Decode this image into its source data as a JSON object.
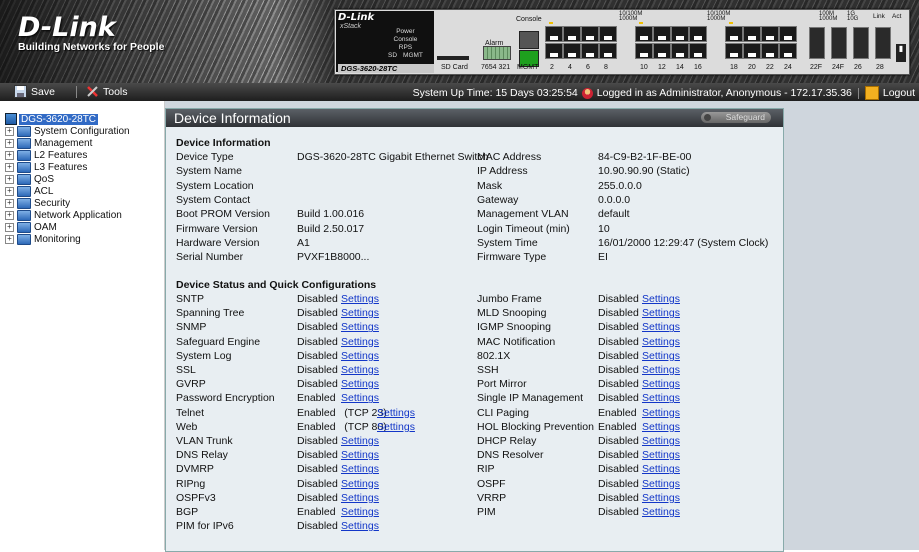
{
  "header": {
    "brand": "D-Link",
    "tagline": "Building Networks for People",
    "panel": {
      "brand": "D-Link",
      "series": "xStack",
      "model": "DGS-3620-28TC",
      "led_labels": [
        "Power",
        "Console",
        "RPS",
        "SD",
        "MGMT"
      ],
      "console_label": "Console",
      "alarm_label": "Alarm",
      "sdcard_label": "SD Card",
      "fan_labels": "7654  321",
      "mgmt_label": "MGMT",
      "port_numbers": [
        "2",
        "4",
        "6",
        "8",
        "10",
        "12",
        "14",
        "16",
        "18",
        "20",
        "22",
        "24",
        "22F",
        "24F",
        "26",
        "28"
      ],
      "speed_legend_1": "10/100M",
      "speed_legend_2": "1000M",
      "speed_legend_3": "100M",
      "speed_legend_4": "1000M",
      "speed_legend_5": "1G",
      "speed_legend_6": "10G",
      "link_act": "Link",
      "act_label": "Act"
    }
  },
  "toolbar": {
    "save_label": "Save",
    "tools_label": "Tools",
    "uptime": "System Up Time: 15 Days 03:25:54",
    "login_info": "Logged in as Administrator, Anonymous - 172.17.35.36",
    "logout_label": "Logout"
  },
  "tree": {
    "root": "DGS-3620-28TC",
    "items": [
      "System Configuration",
      "Management",
      "L2 Features",
      "L3 Features",
      "QoS",
      "ACL",
      "Security",
      "Network Application",
      "OAM",
      "Monitoring"
    ]
  },
  "content": {
    "title": "Device Information",
    "safeguard": "Safeguard",
    "device_info_heading": "Device Information",
    "info_left": [
      {
        "label": "Device Type",
        "value": "DGS-3620-28TC Gigabit Ethernet Switch"
      },
      {
        "label": "System Name",
        "value": ""
      },
      {
        "label": "System Location",
        "value": ""
      },
      {
        "label": "System Contact",
        "value": ""
      },
      {
        "label": "Boot PROM Version",
        "value": "Build 1.00.016"
      },
      {
        "label": "Firmware Version",
        "value": "Build 2.50.017"
      },
      {
        "label": "Hardware Version",
        "value": "A1"
      },
      {
        "label": "Serial Number",
        "value": "PVXF1B8000..."
      }
    ],
    "info_right": [
      {
        "label": "MAC Address",
        "value": "84-C9-B2-1F-BE-00"
      },
      {
        "label": "IP Address",
        "value": "10.90.90.90 (Static)"
      },
      {
        "label": "Mask",
        "value": "255.0.0.0"
      },
      {
        "label": "Gateway",
        "value": "0.0.0.0"
      },
      {
        "label": "Management VLAN",
        "value": "default"
      },
      {
        "label": "Login Timeout (min)",
        "value": "10"
      },
      {
        "label": "System Time",
        "value": "16/01/2000 12:29:47 (System Clock)"
      },
      {
        "label": "Firmware Type",
        "value": "EI"
      }
    ],
    "status_heading": "Device Status and Quick Configurations",
    "settings_label": "Settings",
    "status_left": [
      {
        "label": "SNTP",
        "value": "Disabled"
      },
      {
        "label": "Spanning Tree",
        "value": "Disabled"
      },
      {
        "label": "SNMP",
        "value": "Disabled"
      },
      {
        "label": "Safeguard Engine",
        "value": "Disabled"
      },
      {
        "label": "System Log",
        "value": "Disabled"
      },
      {
        "label": "SSL",
        "value": "Disabled"
      },
      {
        "label": "GVRP",
        "value": "Disabled"
      },
      {
        "label": "Password Encryption",
        "value": "Enabled"
      },
      {
        "label": "Telnet",
        "value": "Enabled   (TCP 23)"
      },
      {
        "label": "Web",
        "value": "Enabled   (TCP 80)"
      },
      {
        "label": "VLAN Trunk",
        "value": "Disabled"
      },
      {
        "label": "DNS Relay",
        "value": "Disabled"
      },
      {
        "label": "DVMRP",
        "value": "Disabled"
      },
      {
        "label": "RIPng",
        "value": "Disabled"
      },
      {
        "label": "OSPFv3",
        "value": "Disabled"
      },
      {
        "label": "BGP",
        "value": "Enabled"
      },
      {
        "label": "PIM for IPv6",
        "value": "Disabled"
      }
    ],
    "status_right": [
      {
        "label": "Jumbo Frame",
        "value": "Disabled"
      },
      {
        "label": "MLD Snooping",
        "value": "Disabled"
      },
      {
        "label": "IGMP Snooping",
        "value": "Disabled"
      },
      {
        "label": "MAC Notification",
        "value": "Disabled"
      },
      {
        "label": "802.1X",
        "value": "Disabled"
      },
      {
        "label": "SSH",
        "value": "Disabled"
      },
      {
        "label": "Port Mirror",
        "value": "Disabled"
      },
      {
        "label": "Single IP Management",
        "value": "Disabled"
      },
      {
        "label": "CLI Paging",
        "value": "Enabled"
      },
      {
        "label": "HOL Blocking Prevention",
        "value": "Enabled"
      },
      {
        "label": "DHCP Relay",
        "value": "Disabled"
      },
      {
        "label": "DNS Resolver",
        "value": "Disabled"
      },
      {
        "label": "RIP",
        "value": "Disabled"
      },
      {
        "label": "OSPF",
        "value": "Disabled"
      },
      {
        "label": "VRRP",
        "value": "Disabled"
      },
      {
        "label": "PIM",
        "value": "Disabled"
      }
    ]
  }
}
